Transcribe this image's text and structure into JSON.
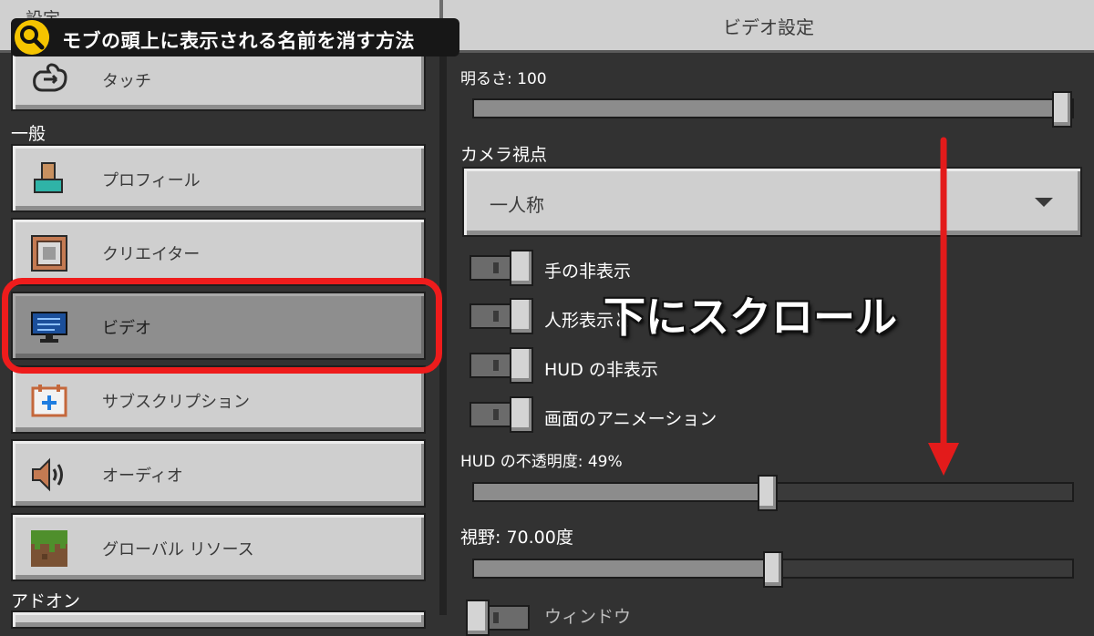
{
  "window": {
    "title": "ビデオ設定",
    "left_header": "設定"
  },
  "caption": {
    "text": "モブの頭上に表示される名前を消す方法",
    "icon": "search-icon"
  },
  "sidebar": {
    "touch_label": "タッチ",
    "section_general": "一般",
    "section_addons": "アドオン",
    "items": [
      {
        "label": "プロフィール",
        "icon": "profile-icon"
      },
      {
        "label": "クリエイター",
        "icon": "creator-icon"
      },
      {
        "label": "ビデオ",
        "icon": "video-monitor-icon",
        "selected": true
      },
      {
        "label": "サブスクリプション",
        "icon": "subscription-icon"
      },
      {
        "label": "オーディオ",
        "icon": "speaker-icon"
      },
      {
        "label": "グローバル リソース",
        "icon": "grass-block-icon"
      }
    ]
  },
  "settings": {
    "brightness": {
      "label": "明るさ: 100",
      "value": 100,
      "max": 100
    },
    "camera": {
      "label": "カメラ視点",
      "value": "一人称"
    },
    "toggles": [
      {
        "label": "手の非表示",
        "on": false
      },
      {
        "label": "人形表示と",
        "on": false
      },
      {
        "label": "HUD の非表示",
        "on": false
      },
      {
        "label": "画面のアニメーション",
        "on": false
      }
    ],
    "hud_opacity": {
      "label": "HUD の不透明度: 49%",
      "value": 49,
      "max": 100
    },
    "fov": {
      "label": "視野: 70.00度",
      "value": 70,
      "min": 30,
      "max": 110
    },
    "partial_toggle_label": "ウィンドウ"
  },
  "overlay": {
    "scroll_text": "下にスクロール"
  },
  "colors": {
    "highlight": "#ee1c1c",
    "arrow": "#e31b1b",
    "caption_bg": "#171717",
    "caption_icon": "#f5c400"
  }
}
